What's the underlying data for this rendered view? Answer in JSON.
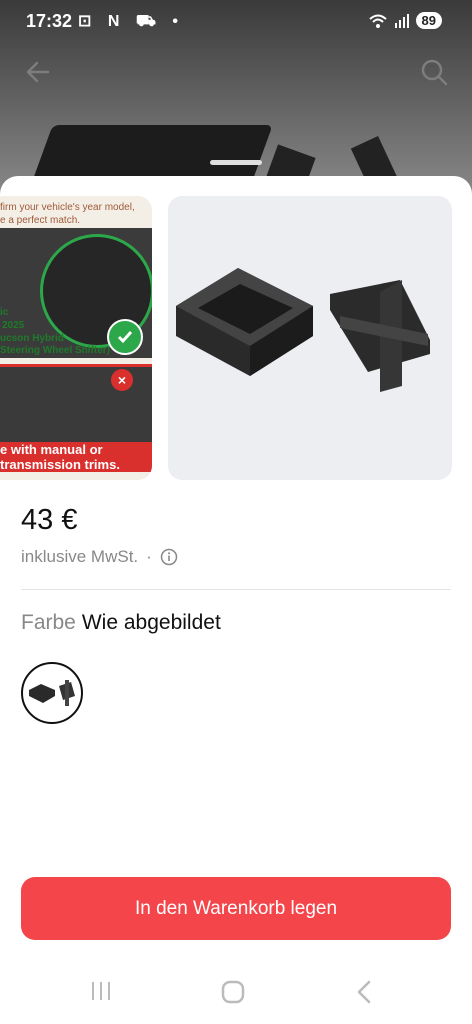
{
  "status_bar": {
    "time": "17:32",
    "left_icons": "⊡ N ⛟ •",
    "battery": "89"
  },
  "header": {
    "back_icon": "arrow-left-icon",
    "search_icon": "search-icon"
  },
  "gallery": {
    "image1_lines": {
      "top1": "firm your vehicle's year model,",
      "top2": "e a perfect match.",
      "model1": "ic",
      "model2": "2025",
      "model3": "ucson Hybrid",
      "model4": "Steering Wheel Shifter)",
      "bottom1": "e with manual or",
      "bottom2": "transmission trims."
    }
  },
  "product": {
    "price": "43 €",
    "tax_note": "inklusive MwSt.",
    "tax_dot": "·",
    "color_label": "Farbe",
    "color_value": "Wie abgebildet"
  },
  "actions": {
    "add_to_cart": "In den Warenkorb legen"
  },
  "colors": {
    "accent": "#f4454a"
  }
}
